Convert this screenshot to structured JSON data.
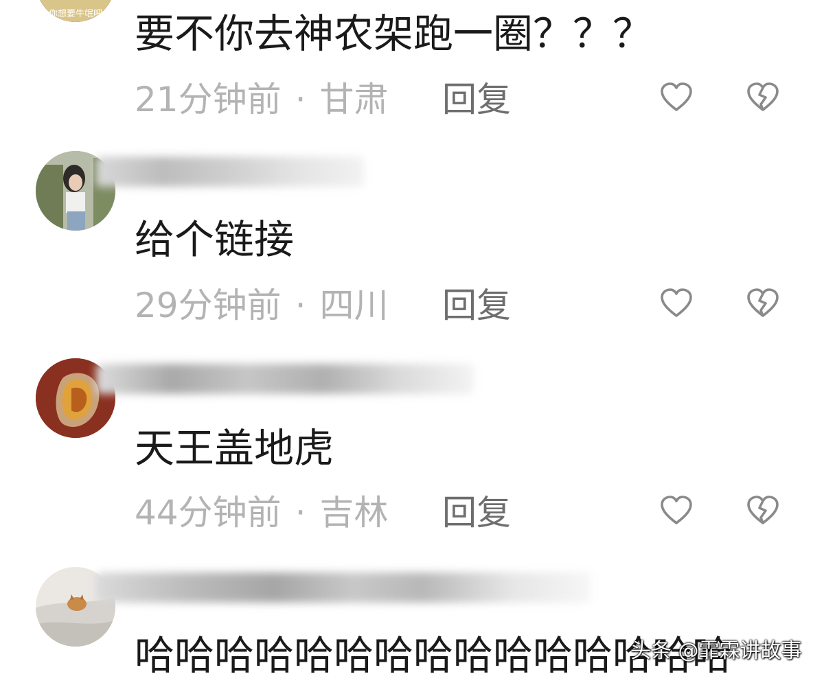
{
  "comments": [
    {
      "text": "要不你去神农架跑一圈？？？",
      "time": "21分钟前",
      "separator": "·",
      "location": "甘肃",
      "reply_label": "回复",
      "avatar_caption": "你想要牛氓吧"
    },
    {
      "text": "给个链接",
      "time": "29分钟前",
      "separator": "·",
      "location": "四川",
      "reply_label": "回复"
    },
    {
      "text": "天王盖地虎",
      "time": "44分钟前",
      "separator": "·",
      "location": "吉林",
      "reply_label": "回复"
    },
    {
      "text": "哈哈哈哈哈哈哈哈哈哈哈哈哈哈哈"
    }
  ],
  "icons": {
    "like": "heart-outline-icon",
    "dislike": "broken-heart-icon"
  },
  "watermark": "头条 @霏霖讲故事",
  "colors": {
    "text": "#1a1a1a",
    "meta": "#b3b3b3",
    "reply": "#6e6e6e",
    "icon": "#8a8a8a"
  }
}
